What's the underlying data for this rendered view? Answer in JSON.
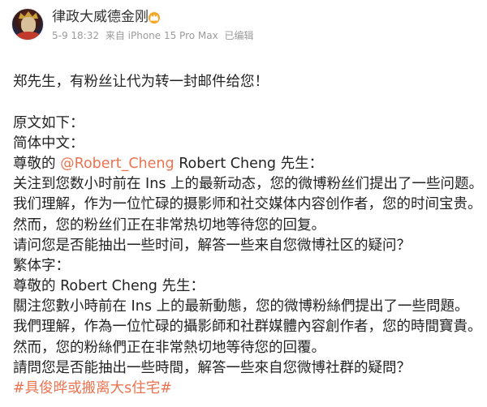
{
  "post": {
    "username": "律政大威德金刚",
    "badge_icon": "vip-crown-icon",
    "meta": {
      "date": "5-9 18:32",
      "source": "来自 iPhone 15 Pro Max",
      "edited": "已编辑"
    },
    "greeting": "郑先生，有粉丝让代为转一封邮件给您！",
    "original_label": "原文如下：",
    "simplified": {
      "label": "简体中文：",
      "salutation_prefix": "尊敬的 ",
      "mention": "@Robert_Cheng",
      "salutation_suffix": " Robert Cheng 先生：",
      "lines": [
        "关注到您数小时前在 Ins 上的最新动态，您的微博粉丝们提出了一些问题。",
        "我们理解，作为一位忙碌的摄影师和社交媒体内容创作者，您的时间宝贵。",
        "然而，您的粉丝们正在非常热切地等待您的回复。",
        "请问您是否能抽出一些时间，解答一些来自您微博社区的疑问？"
      ]
    },
    "traditional": {
      "label": "繁体字：",
      "salutation": "尊敬的 Robert Cheng 先生：",
      "lines": [
        "關注您數小時前在 Ins 上的最新動態，您的微博粉絲們提出了一些問題。",
        "我們理解，作為一位忙碌的攝影師和社群媒體內容創作者，您的時間寶貴。",
        "然而，您的粉絲們正在非常熱切地等待您的回覆。",
        "請問您是否能抽出一些時間，解答一些來自您微博社群的疑問？"
      ]
    },
    "hashtag": "#具俊晔或搬离大s住宅#",
    "colors": {
      "link": "#eb7350",
      "meta": "#9b9b9b",
      "text": "#232323"
    }
  }
}
